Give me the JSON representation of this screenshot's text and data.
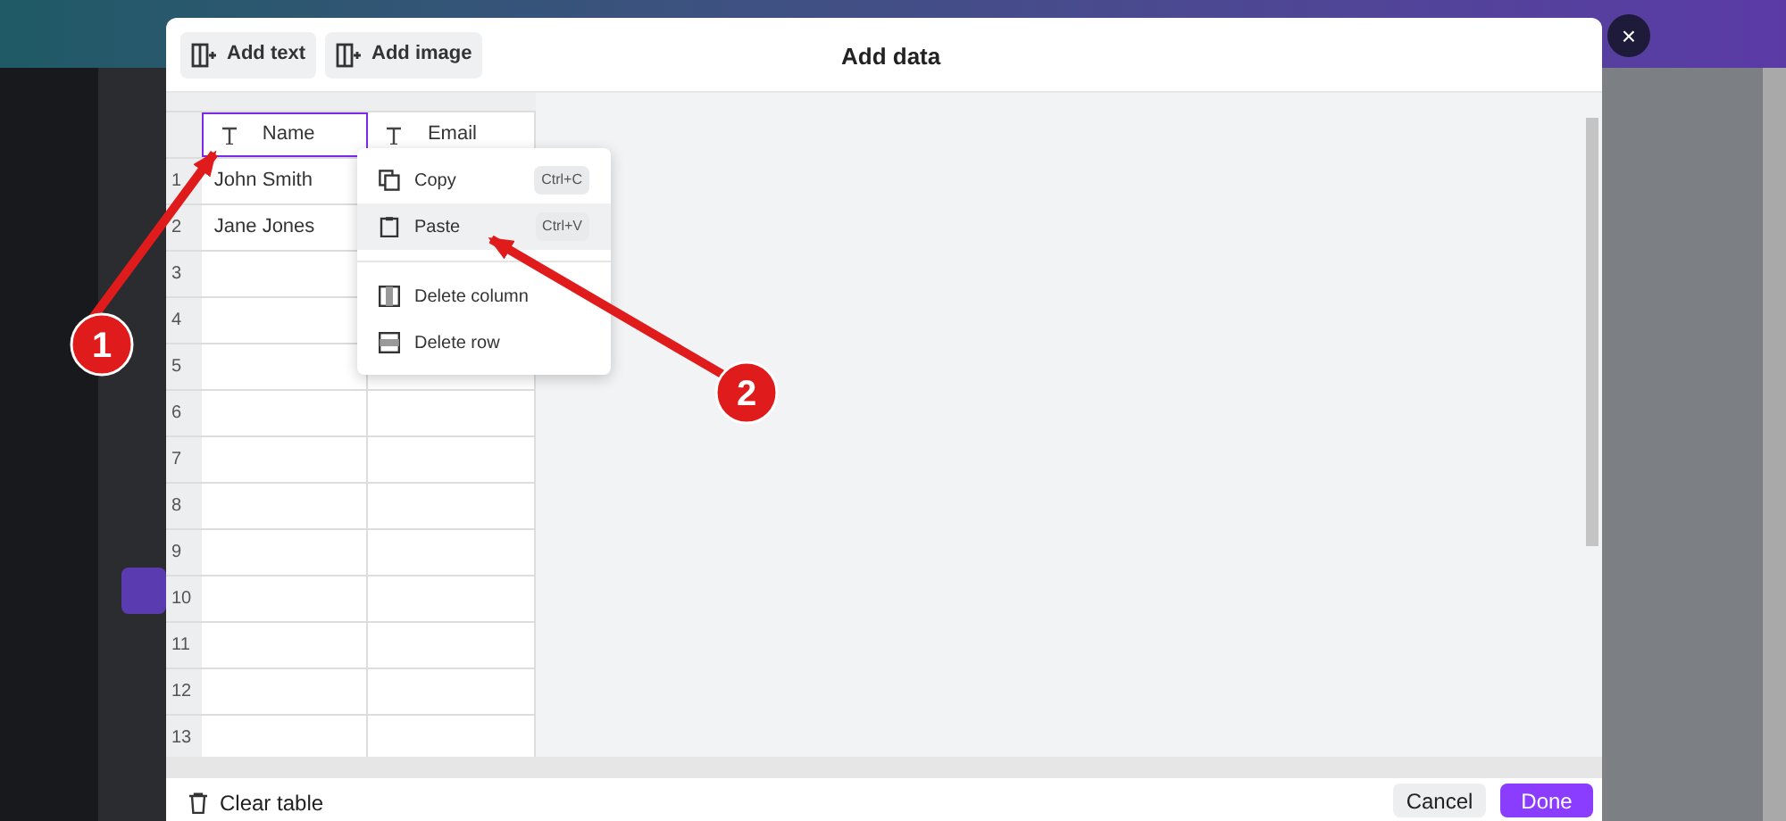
{
  "dialog": {
    "title": "Add data",
    "close": "×",
    "toolbar": [
      {
        "label": "Add text"
      },
      {
        "label": "Add image"
      }
    ],
    "table": {
      "columns": [
        {
          "label": "Name",
          "selected": true
        },
        {
          "label": "Email",
          "selected": false
        }
      ],
      "rows": [
        {
          "number": "1",
          "cells": [
            "John Smith"
          ]
        },
        {
          "number": "2",
          "cells": [
            "Jane Jones"
          ]
        },
        {
          "number": "3"
        },
        {
          "number": "4"
        },
        {
          "number": "5"
        },
        {
          "number": "6"
        },
        {
          "number": "7"
        },
        {
          "number": "8"
        },
        {
          "number": "9"
        },
        {
          "number": "10"
        },
        {
          "number": "11"
        },
        {
          "number": "12"
        },
        {
          "number": "13"
        }
      ]
    },
    "context_menu": [
      {
        "kind": "copy",
        "label": "Copy",
        "shortcut": "Ctrl+C",
        "selected": false
      },
      {
        "kind": "paste",
        "label": "Paste",
        "shortcut": "Ctrl+V",
        "selected": true
      },
      {
        "kind": "delete-column",
        "label": "Delete column",
        "selected": false
      },
      {
        "kind": "delete-row",
        "label": "Delete row",
        "selected": false
      }
    ],
    "footer": {
      "clear": "Clear table",
      "cancel": "Cancel",
      "done": "Done"
    }
  },
  "annotations": [
    {
      "label": "1"
    },
    {
      "label": "2"
    }
  ]
}
